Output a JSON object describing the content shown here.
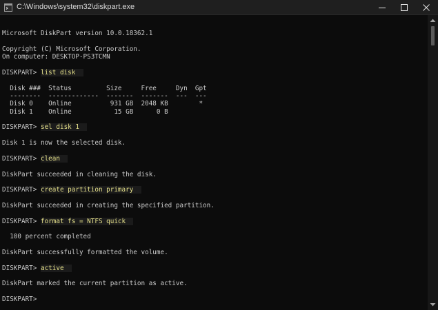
{
  "window": {
    "title": "C:\\Windows\\system32\\diskpart.exe",
    "icon": "console-app-icon",
    "controls": [
      "minimize-icon",
      "maximize-icon",
      "close-icon"
    ]
  },
  "colors": {
    "background": "#0c0c0c",
    "text": "#cccccc",
    "command": "#e5e08a",
    "titlebar": "#1f1f1f"
  },
  "console": {
    "lines": [
      {
        "text": ""
      },
      {
        "text": "Microsoft DiskPart version 10.0.18362.1"
      },
      {
        "text": ""
      },
      {
        "text": "Copyright (C) Microsoft Corporation."
      },
      {
        "text": "On computer: DESKTOP-PS3TCMN"
      },
      {
        "text": ""
      },
      {
        "prompt": "DISKPART> ",
        "command": "list disk"
      },
      {
        "text": ""
      },
      {
        "text": "  Disk ###  Status         Size     Free     Dyn  Gpt"
      },
      {
        "text": "  --------  -------------  -------  -------  ---  ---"
      },
      {
        "text": "  Disk 0    Online          931 GB  2048 KB        *"
      },
      {
        "text": "  Disk 1    Online           15 GB      0 B"
      },
      {
        "text": ""
      },
      {
        "prompt": "DISKPART> ",
        "command": "sel disk 1"
      },
      {
        "text": ""
      },
      {
        "text": "Disk 1 is now the selected disk."
      },
      {
        "text": ""
      },
      {
        "prompt": "DISKPART> ",
        "command": "clean"
      },
      {
        "text": ""
      },
      {
        "text": "DiskPart succeeded in cleaning the disk."
      },
      {
        "text": ""
      },
      {
        "prompt": "DISKPART> ",
        "command": "create partition primary"
      },
      {
        "text": ""
      },
      {
        "text": "DiskPart succeeded in creating the specified partition."
      },
      {
        "text": ""
      },
      {
        "prompt": "DISKPART> ",
        "command": "format fs = NTFS quick"
      },
      {
        "text": ""
      },
      {
        "text": "  100 percent completed"
      },
      {
        "text": ""
      },
      {
        "text": "DiskPart successfully formatted the volume."
      },
      {
        "text": ""
      },
      {
        "prompt": "DISKPART> ",
        "command": "active"
      },
      {
        "text": ""
      },
      {
        "text": "DiskPart marked the current partition as active."
      },
      {
        "text": ""
      },
      {
        "prompt": "DISKPART> ",
        "command": ""
      }
    ]
  }
}
